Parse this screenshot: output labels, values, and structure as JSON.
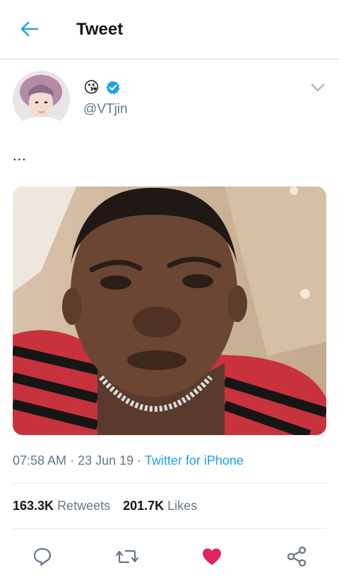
{
  "header": {
    "title": "Tweet",
    "back_icon": "arrow-left-icon"
  },
  "author": {
    "emoji": "😘",
    "verified": true,
    "handle": "@VTjin",
    "menu_icon": "chevron-down-icon"
  },
  "tweet": {
    "text": "...",
    "time": "07:58 AM",
    "date": "23 Jun 19",
    "source": "Twitter for iPhone",
    "separator": "·"
  },
  "stats": {
    "retweets_count": "163.3K",
    "retweets_label": "Retweets",
    "likes_count": "201.7K",
    "likes_label": "Likes"
  },
  "actions": {
    "reply_icon": "reply-icon",
    "retweet_icon": "retweet-icon",
    "like_icon": "heart-filled-icon",
    "share_icon": "share-icon"
  },
  "colors": {
    "accent": "#1da1f2",
    "like": "#e0245e",
    "secondary_text": "#657786"
  }
}
